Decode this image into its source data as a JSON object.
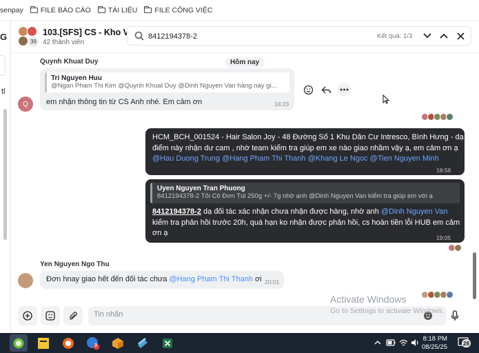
{
  "bookmarks": [
    {
      "label": "senpay",
      "folder": false
    },
    {
      "label": "FILE BÁO CÁO",
      "folder": true
    },
    {
      "label": "TÀI LIỆU",
      "folder": true
    },
    {
      "label": "FILE CÔNG VIỆC",
      "folder": true
    }
  ],
  "left_panel": {
    "letter": "G",
    "text": "tl"
  },
  "header": {
    "group_name": "103.[SFS] CS - Kho Vận",
    "member_count": "42 thành viên",
    "avatar_badge": "39",
    "search_value": "8412194378-2",
    "result_count": "Kết quả: 1/3"
  },
  "date_separator": "Hôm nay",
  "messages": {
    "m1": {
      "sender": "Quynh Khuat Duy",
      "avatar_letter": "Q",
      "quote_name": "Tri Nguyen Huu",
      "quote_text": "@Ngan Pham Thi Kim @Quynh Khuat Duy @Dinh Nguyen Van hàng này gi...",
      "text": "em nhận thông tin từ CS Anh nhé. Em cảm ơn",
      "time": "18:23"
    },
    "m2": {
      "line1": "HCM_BCH_001524  - Hair Salon Joy - 48 Đường Số 1 Khu Dân Cư Intresco, Bình Hưng   - dạ",
      "line2": "điểm này nhận dư cam , nhờ team kiểm tra giúp em xe nào giao nhầm vậy ạ, em cảm ơn ạ",
      "mentions": [
        "@Hau Duong Trung",
        "@Hang Pham Thi Thanh",
        "@Khang Le Ngoc",
        "@Tien Nguyen Minh"
      ],
      "time": "18:56"
    },
    "m3": {
      "quote_name": "Uyen Nguyen Tran Phuong",
      "quote_text": "8412194378-2 Tỏi Cô Đơn Túi 250g +/- 7g nhờ anh @Dinh Nguyen Van kiểm tra giúp em với ạ",
      "code": "8412194378-2",
      "text_a": " dạ đối tác xác  nhận chưa nhận được hàng, nhờ anh ",
      "mention": "@Dinh Nguyen Van",
      "line2": "kiểm tra phản hồi trước 20h, quá hạn ko nhận được phản hồi, cs hoàn tiền lỗi HUB em cảm",
      "line3": "ơn ạ",
      "time": "19:05"
    },
    "m4": {
      "sender": "Yen Nguyen Ngo Thu",
      "text_a": "Đơn hnay giao hết đến đối tác chưa ",
      "mention": "@Hang Pham Thi Thanh",
      "text_b": " ơi",
      "time": "20:01"
    }
  },
  "composer": {
    "placeholder": "Tin nhắn"
  },
  "watermark": {
    "title": "Activate Windows",
    "subtitle": "Go to Settings to activate Windows."
  },
  "taskbar": {
    "time": "8:18 PM",
    "date": "08/25/25",
    "notification_count": "28",
    "chat_badge": "3"
  },
  "colors": {
    "mention": "#4f8ff7",
    "dark_bubble": "#2a2b2e",
    "taskbar": "#1b2431"
  }
}
